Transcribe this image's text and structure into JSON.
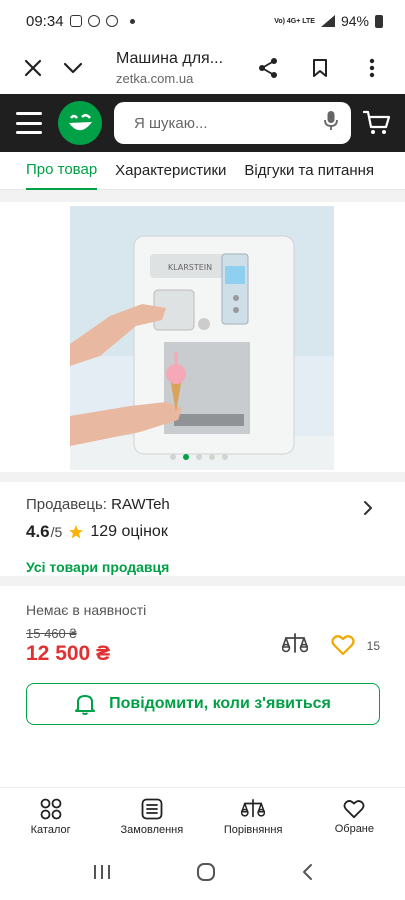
{
  "status_bar": {
    "time": "09:34",
    "network": "Vo) 4G+ LTE",
    "battery": "94%"
  },
  "browser": {
    "title": "Машина для...",
    "url": "zetka.com.ua"
  },
  "header": {
    "search_placeholder": "Я шукаю..."
  },
  "tabs": [
    {
      "label": "Про товар",
      "active": true
    },
    {
      "label": "Характеристики",
      "active": false
    },
    {
      "label": "Відгуки та питання",
      "active": false
    }
  ],
  "image": {
    "alt": "KLARSTEIN",
    "slides": 5,
    "active_slide": 2
  },
  "seller": {
    "label": "Продавець:",
    "name": "RAWTeh",
    "rating": "4.6",
    "rating_max": "/5",
    "reviews": "129 оцінок",
    "all_goods": "Усі товари продавця"
  },
  "price": {
    "availability": "Немає в наявності",
    "old_price": "15 460 ₴",
    "new_price": "12 500 ₴",
    "favorites_count": "15",
    "notify_label": "Повідомити, коли з'явиться"
  },
  "bottom_nav": [
    {
      "label": "Каталог",
      "icon": "catalog-icon"
    },
    {
      "label": "Замовлення",
      "icon": "orders-icon"
    },
    {
      "label": "Порівняння",
      "icon": "compare-icon"
    },
    {
      "label": "Обране",
      "icon": "heart-icon"
    }
  ],
  "colors": {
    "accent": "#00a046",
    "price": "#e03131",
    "header": "#1f1f1f"
  }
}
